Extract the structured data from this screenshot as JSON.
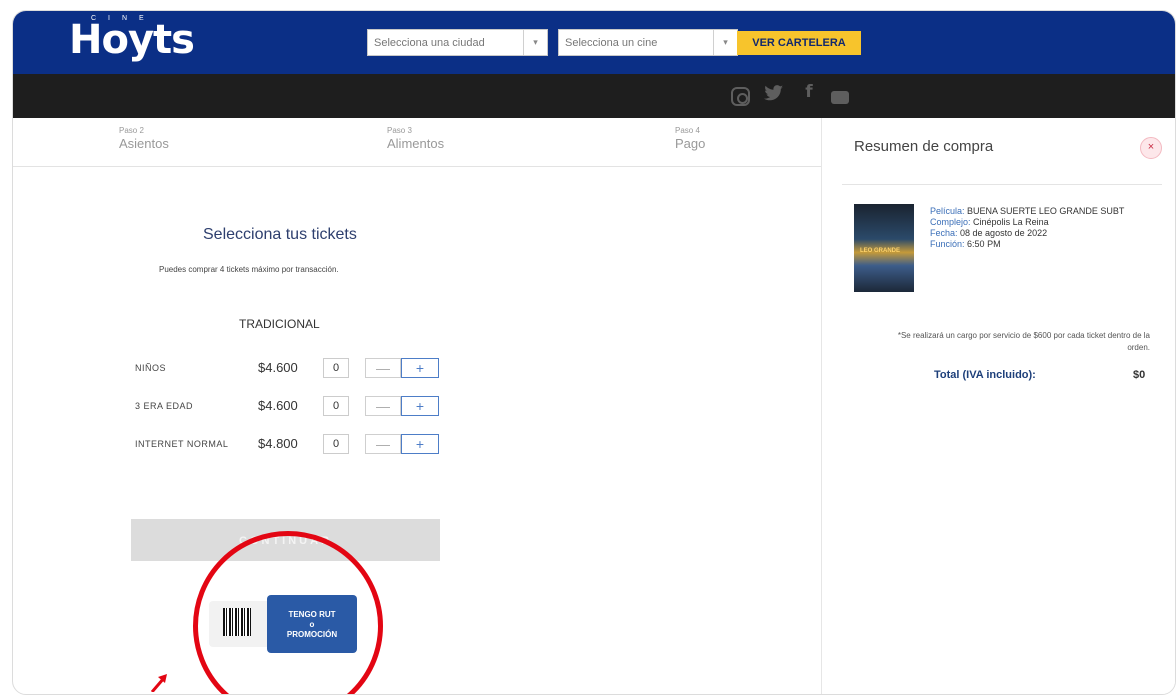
{
  "header": {
    "logo_text": "Hoyts",
    "logo_sub": "CINE",
    "city_select_placeholder": "Selecciona una ciudad",
    "cinema_select_placeholder": "Selecciona un cine",
    "cartelera_button": "VER CARTELERA",
    "brand_color": "#0b2f86",
    "accent_color": "#f7c42c"
  },
  "social": [
    "instagram-icon",
    "twitter-icon",
    "facebook-icon",
    "youtube-icon"
  ],
  "steps": [
    {
      "num": "Paso 2",
      "name": "Asientos"
    },
    {
      "num": "Paso 3",
      "name": "Alimentos"
    },
    {
      "num": "Paso 4",
      "name": "Pago"
    }
  ],
  "tickets": {
    "title": "Selecciona tus tickets",
    "subtitle": "Puedes comprar 4 tickets máximo por transacción.",
    "section": "TRADICIONAL",
    "rows": [
      {
        "label": "NIÑOS",
        "price": "$4.600",
        "qty": "0"
      },
      {
        "label": "3 ERA EDAD",
        "price": "$4.600",
        "qty": "0"
      },
      {
        "label": "INTERNET NORMAL",
        "price": "$4.800",
        "qty": "0"
      }
    ],
    "minus": "—",
    "plus": "+",
    "continue_button": "CONTINUAR"
  },
  "promo": {
    "line1": "TENGO RUT",
    "line2": "o",
    "line3": "PROMOCIÓN"
  },
  "summary": {
    "title": "Resumen de compra",
    "close": "×",
    "poster_text": "LEO GRANDE",
    "pelicula_key": "Película:",
    "pelicula_val": "BUENA SUERTE LEO GRANDE SUBT",
    "complejo_key": "Complejo:",
    "complejo_val": "Cinépolis La Reina",
    "fecha_key": "Fecha:",
    "fecha_val": "08 de agosto de 2022",
    "funcion_key": "Función:",
    "funcion_val": "6:50 PM",
    "note": "*Se realizará un cargo por servicio de $600 por cada ticket dentro de la orden.",
    "total_label": "Total (IVA incluido):",
    "total_value": "$0"
  },
  "annotation_color": "#e30613"
}
